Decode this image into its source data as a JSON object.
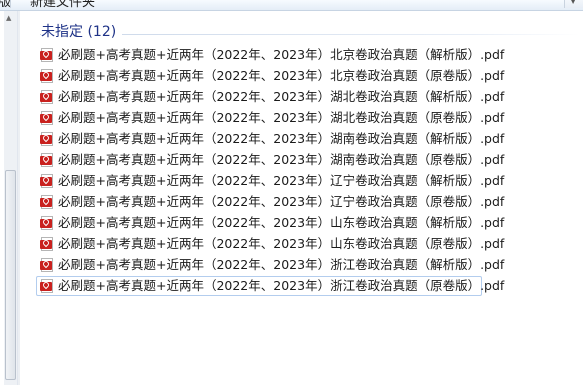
{
  "toolbar": {
    "left_label": "版",
    "center_label": "新建文件夹",
    "right_menu_icon": "chevron-down-icon"
  },
  "group": {
    "title": "未指定 (12)"
  },
  "files": [
    {
      "name": "必刷题+高考真题+近两年（2022年、2023年）北京卷政治真题（解析版）.pdf",
      "icon": "pdf-icon"
    },
    {
      "name": "必刷题+高考真题+近两年（2022年、2023年）北京卷政治真题（原卷版）.pdf",
      "icon": "pdf-icon"
    },
    {
      "name": "必刷题+高考真题+近两年（2022年、2023年）湖北卷政治真题（解析版）.pdf",
      "icon": "pdf-icon"
    },
    {
      "name": "必刷题+高考真题+近两年（2022年、2023年）湖北卷政治真题（原卷版）.pdf",
      "icon": "pdf-icon"
    },
    {
      "name": "必刷题+高考真题+近两年（2022年、2023年）湖南卷政治真题（解析版）.pdf",
      "icon": "pdf-icon"
    },
    {
      "name": "必刷题+高考真题+近两年（2022年、2023年）湖南卷政治真题（原卷版）.pdf",
      "icon": "pdf-icon"
    },
    {
      "name": "必刷题+高考真题+近两年（2022年、2023年）辽宁卷政治真题（解析版）.pdf",
      "icon": "pdf-icon"
    },
    {
      "name": "必刷题+高考真题+近两年（2022年、2023年）辽宁卷政治真题（原卷版）.pdf",
      "icon": "pdf-icon"
    },
    {
      "name": "必刷题+高考真题+近两年（2022年、2023年）山东卷政治真题（解析版）.pdf",
      "icon": "pdf-icon"
    },
    {
      "name": "必刷题+高考真题+近两年（2022年、2023年）山东卷政治真题（原卷版）.pdf",
      "icon": "pdf-icon"
    },
    {
      "name": "必刷题+高考真题+近两年（2022年、2023年）浙江卷政治真题（解析版）.pdf",
      "icon": "pdf-icon"
    },
    {
      "name": "必刷题+高考真题+近两年（2022年、2023年）浙江卷政治真题（原卷版）.pdf",
      "icon": "pdf-icon",
      "focused": true
    }
  ]
}
